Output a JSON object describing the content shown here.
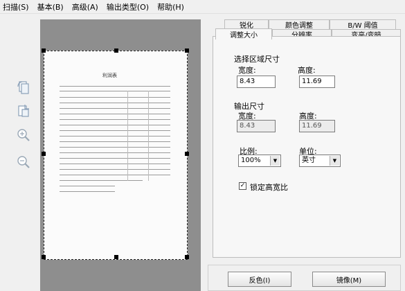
{
  "menu": [
    "扫描(S)",
    "基本(B)",
    "高级(A)",
    "输出类型(O)",
    "帮助(H)"
  ],
  "toolbar": {
    "icons": [
      "rotate-page-icon",
      "crop-page-icon",
      "zoom-in-icon",
      "zoom-out-icon"
    ]
  },
  "preview": {
    "doc_title": "利润表"
  },
  "tabs": {
    "row1": [
      "锐化",
      "颜色调整",
      "B/W 阈值"
    ],
    "row2": [
      "调整大小",
      "分辨率",
      "变亮/变暗"
    ],
    "active": "调整大小"
  },
  "resize": {
    "select_area_label": "选择区域尺寸",
    "width_label": "宽度:",
    "height_label": "高度:",
    "select_width": "8.43",
    "select_height": "11.69",
    "output_label": "输出尺寸",
    "out_width_label": "宽度:",
    "out_height_label": "高度:",
    "out_width": "8.43",
    "out_height": "11.69",
    "scale_label": "比例:",
    "scale_value": "100%",
    "unit_label": "单位:",
    "unit_value": "英寸",
    "lock_label": "锁定高宽比",
    "lock_checked": "✓"
  },
  "buttons": {
    "invert": "反色(I)",
    "mirror": "镜像(M)"
  }
}
